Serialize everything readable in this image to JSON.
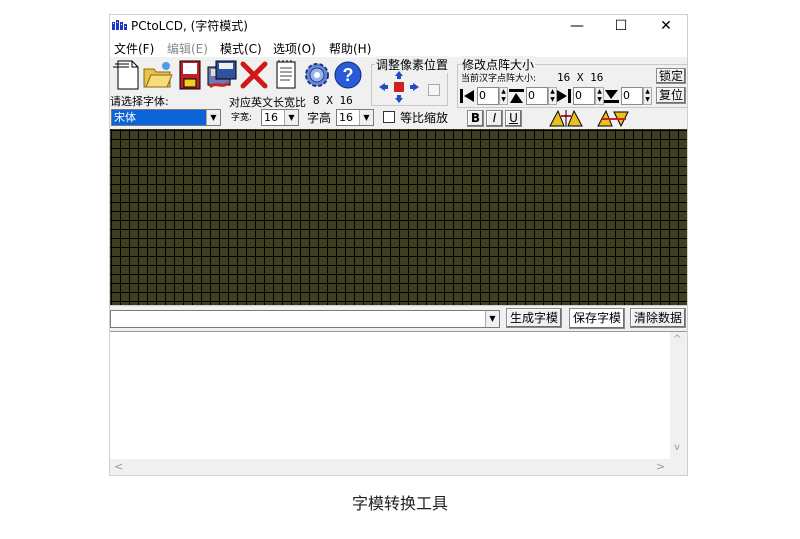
{
  "window": {
    "title": "PCtoLCD, (字符模式)",
    "minimize": "—",
    "maximize": "☐",
    "close": "✕"
  },
  "menu": {
    "file": "文件(F)",
    "edit": "编辑(E)",
    "mode": "模式(C)",
    "options": "选项(O)",
    "help": "帮助(H)"
  },
  "toolbar": {
    "icons": [
      "new-document-icon",
      "open-folder-icon",
      "save-icon",
      "save-as-icon",
      "delete-icon",
      "notepad-icon",
      "settings-gear-icon",
      "help-icon"
    ],
    "help_glyph": "?"
  },
  "font": {
    "select_label": "请选择字体:",
    "ratio_label": "对应英文长宽比",
    "ratio_value": "8 X 16",
    "font_value": "宋体",
    "width_label": "字宽:",
    "width_value": "16",
    "height_label": "字高",
    "height_value": "16",
    "proportional_label": "等比缩放",
    "proportional_checked": false,
    "bold": "B",
    "italic": "I",
    "underline": "U"
  },
  "adjust": {
    "title": "调整像素位置"
  },
  "dotsize": {
    "title": "修改点阵大小",
    "current_label": "当前汉字点阵大小:",
    "current_value": "16 X 16",
    "lock": "锁定",
    "reset": "复位",
    "spins": [
      "0",
      "0",
      "0",
      "0"
    ]
  },
  "bottom": {
    "generate": "生成字模",
    "save": "保存字模",
    "clear": "清除数据",
    "combo_value": ""
  },
  "scroll": {
    "up": "^",
    "down": "v",
    "left": "<",
    "right": ">"
  },
  "caption": "字模转换工具",
  "colors": {
    "grid_cell": "#3e3e21",
    "grid_line": "#000000",
    "selection": "#0a64d8"
  }
}
